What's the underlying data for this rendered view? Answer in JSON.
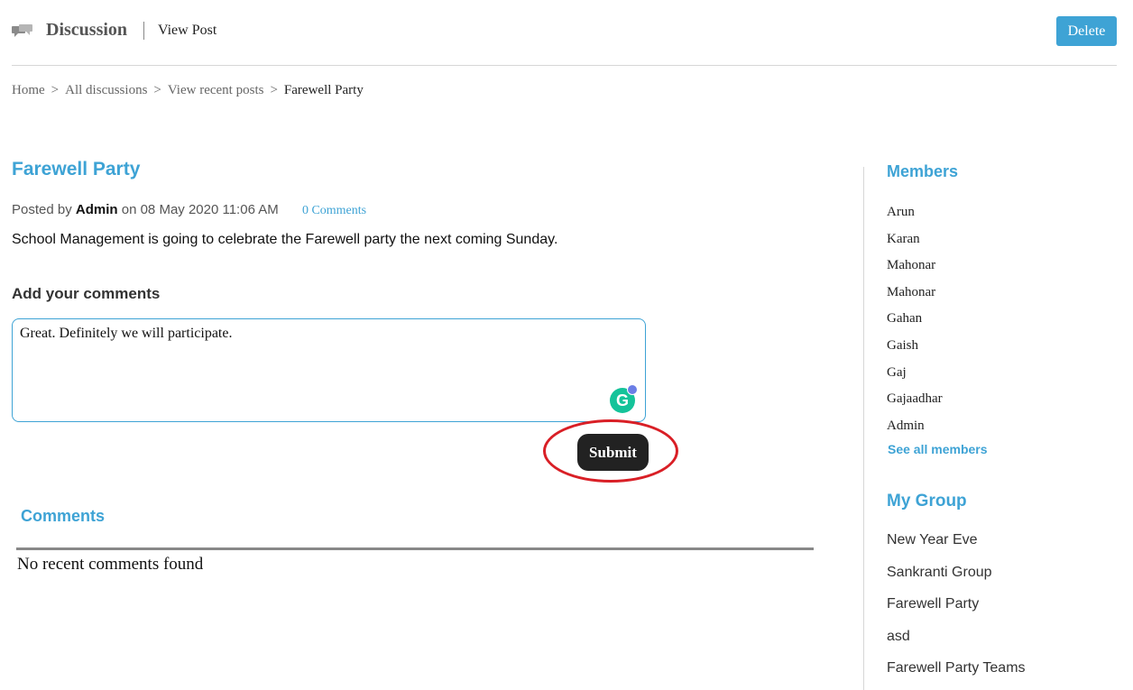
{
  "header": {
    "module_title": "Discussion",
    "page_subtitle": "View Post",
    "delete_label": "Delete",
    "icon": "discussion-bubbles-icon"
  },
  "breadcrumb": {
    "items": [
      "Home",
      "All discussions",
      "View recent posts",
      "Farewell Party"
    ],
    "separator": ">"
  },
  "post": {
    "title": "Farewell Party",
    "posted_by_prefix": "Posted by",
    "author": "Admin",
    "date_prefix": "on",
    "date": "08 May 2020 11:06 AM",
    "comments_link": "0 Comments",
    "body": "School Management is going to celebrate the Farewell party the next coming Sunday."
  },
  "add_comment": {
    "title": "Add your comments",
    "value": "Great. Definitely we will participate.",
    "submit_label": "Submit",
    "grammarly_letter": "G"
  },
  "comments": {
    "title": "Comments",
    "empty_text": "No recent comments found"
  },
  "sidebar": {
    "members_title": "Members",
    "members": [
      "Arun",
      "Karan",
      "Mahonar",
      "Mahonar",
      "Gahan",
      "Gaish",
      "Gaj",
      "Gajaadhar",
      "Admin"
    ],
    "see_all_label": "See all members",
    "group_title": "My Group",
    "groups": [
      "New Year Eve",
      "Sankranti Group",
      "Farewell Party",
      "asd",
      "Farewell Party Teams"
    ]
  },
  "colors": {
    "accent": "#3ea3d5",
    "submit_bg": "#222222",
    "annotation": "#d91f26",
    "grammarly": "#15c39a"
  }
}
